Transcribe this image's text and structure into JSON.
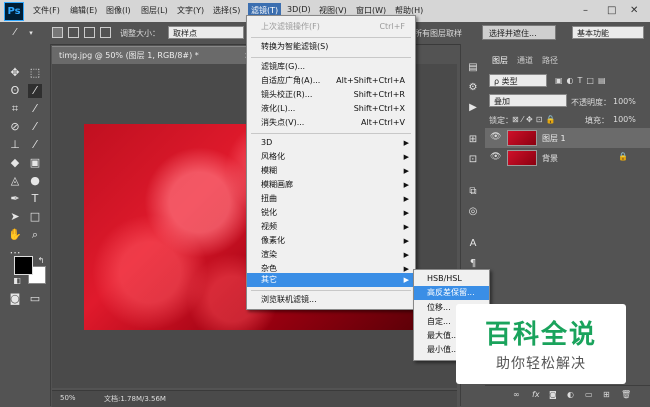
{
  "menubar": {
    "logo": "Ps",
    "items": [
      "文件(F)",
      "编辑(E)",
      "图像(I)",
      "图层(L)",
      "文字(Y)",
      "选择(S)",
      "滤镜(T)",
      "3D(D)",
      "视图(V)",
      "窗口(W)",
      "帮助(H)"
    ],
    "active_index": 6,
    "window_controls": [
      "–",
      "□",
      "✕"
    ]
  },
  "options_bar": {
    "brush_size_label": "调整大小：",
    "brush_size_value": "取样点",
    "right_fragment": "所有图层取样",
    "select_button": "选择并遮住...",
    "workspace": "基本功能"
  },
  "document": {
    "tab_title": "timg.jpg @ 50% (图层 1, RGB/8#) *",
    "tab_close": "×",
    "status_zoom": "50%",
    "status_doc": "文档:1.78M/3.56M"
  },
  "filter_menu": {
    "last_filter": "上次滤镜操作(F)",
    "last_filter_shortcut": "Ctrl+F",
    "smart_filter": "转换为智能滤镜(S)",
    "group1": [
      {
        "label": "滤镜库(G)...",
        "shortcut": ""
      },
      {
        "label": "自适应广角(A)...",
        "shortcut": "Alt+Shift+Ctrl+A"
      },
      {
        "label": "镜头校正(R)...",
        "shortcut": "Shift+Ctrl+R"
      },
      {
        "label": "液化(L)...",
        "shortcut": "Shift+Ctrl+X"
      },
      {
        "label": "消失点(V)...",
        "shortcut": "Alt+Ctrl+V"
      }
    ],
    "group2": [
      "3D",
      "风格化",
      "模糊",
      "模糊画廊",
      "扭曲",
      "锐化",
      "视频",
      "像素化",
      "渲染",
      "杂色",
      "其它"
    ],
    "highlighted": "其它",
    "browse_online": "浏览联机滤镜..."
  },
  "other_submenu": {
    "items": [
      "HSB/HSL",
      "高反差保留...",
      "位移...",
      "自定...",
      "最大值...",
      "最小值..."
    ],
    "highlighted_index": 1
  },
  "layers_panel": {
    "tabs": [
      "图层",
      "通道",
      "路径"
    ],
    "active_tab": "图层",
    "filter_kind": "ρ 类型",
    "blend_mode": "叠加",
    "opacity_label": "不透明度：",
    "opacity_value": "100%",
    "lock_label": "锁定：",
    "fill_label": "填充：",
    "fill_value": "100%",
    "layers": [
      {
        "name": "图层 1",
        "selected": true,
        "locked": false
      },
      {
        "name": "背景",
        "selected": false,
        "locked": true
      }
    ],
    "footer_icons": [
      "link-icon",
      "fx",
      "mask-icon",
      "adjustment-icon",
      "group-icon",
      "new-layer-icon",
      "trash-icon"
    ],
    "fx_label": "fx"
  },
  "watermark": {
    "title": "百科全说",
    "subtitle": "助你轻松解决"
  },
  "colors": {
    "menu_highlight": "#3a8ee6",
    "watermark_green": "#1aa35c",
    "photo_red": "#d0102a"
  }
}
